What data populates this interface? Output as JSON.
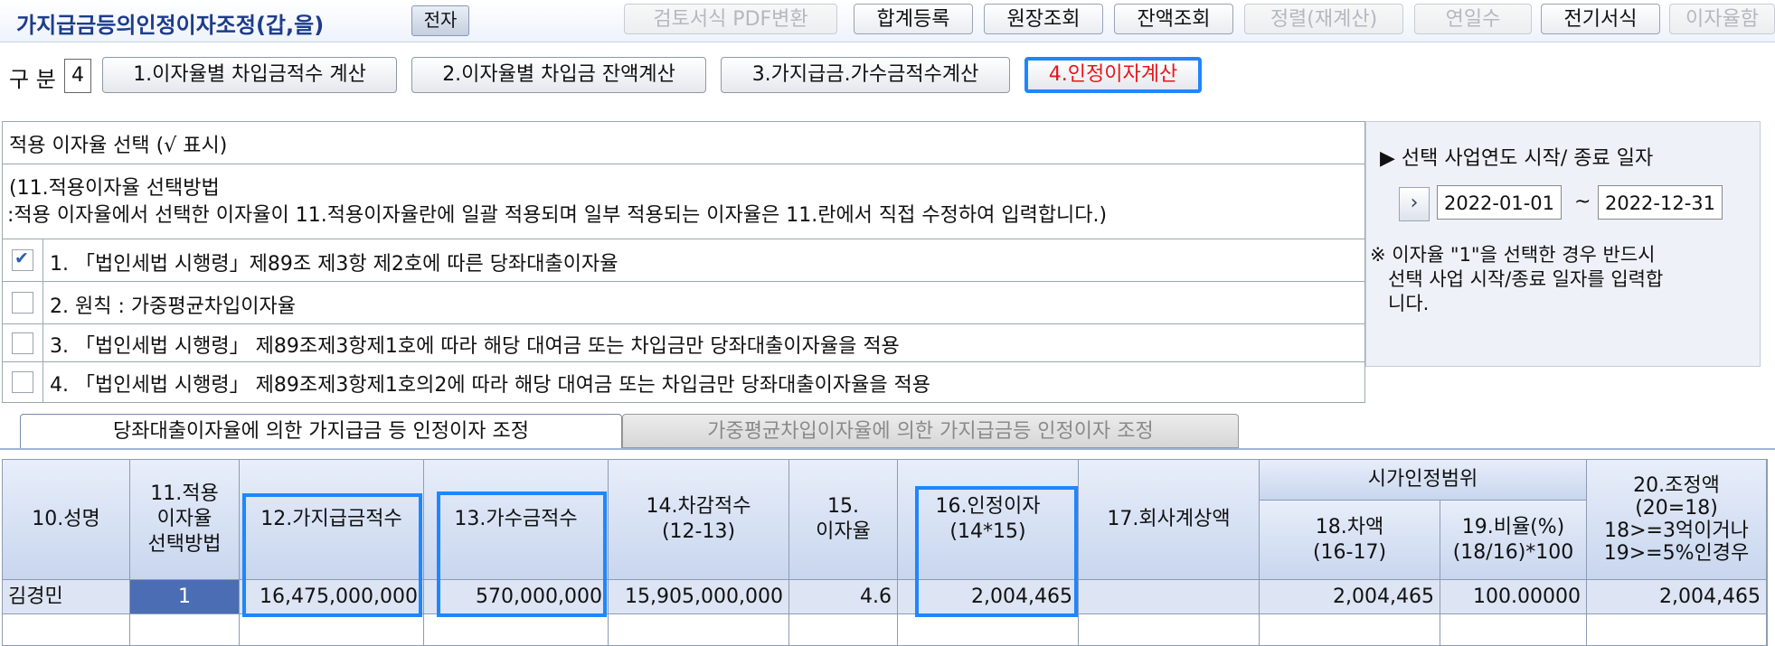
{
  "toolbar": {
    "title": "가지급금등의인정이자조정(갑,을)",
    "electronic_button": "전자",
    "buttons": [
      {
        "label": "검토서식 PDF변환",
        "enabled": false
      },
      {
        "label": "합계등록",
        "enabled": true
      },
      {
        "label": "원장조회",
        "enabled": true
      },
      {
        "label": "잔액조회",
        "enabled": true
      },
      {
        "label": "정렬(재계산)",
        "enabled": false
      },
      {
        "label": "연일수",
        "enabled": false
      },
      {
        "label": "전기서식",
        "enabled": true
      },
      {
        "label": "이자율함",
        "enabled": false
      }
    ]
  },
  "category": {
    "label": "구 분",
    "value": "4",
    "buttons": [
      "1.이자율별 차입금적수 계산",
      "2.이자율별 차입금 잔액계산",
      "3.가지급금.가수금적수계산",
      "4.인정이자계산"
    ],
    "active_index": 3
  },
  "rate_selection": {
    "header": "적용 이자율 선택 (√ 표시)",
    "method_line1": "(11.적용이자율 선택방법",
    "method_line2": " :적용 이자율에서 선택한 이자율이 11.적용이자율란에 일괄 적용되며 일부 적용되는 이자율은 11.란에서 직접 수정하여 입력합니다.)",
    "options": [
      {
        "text": "1. 「법인세법 시행령」제89조 제3항 제2호에 따른 당좌대출이자율",
        "checked": true
      },
      {
        "text": "2.  원칙 : 가중평균차입이자율",
        "checked": false
      },
      {
        "text": "3. 「법인세법 시행령」 제89조제3항제1호에 따라 해당 대여금 또는 차입금만 당좌대출이자율을 적용",
        "checked": false
      },
      {
        "text": "4. 「법인세법 시행령」 제89조제3항제1호의2에 따라 해당 대여금 또는 차입금만 당좌대출이자율을 적용",
        "checked": false
      }
    ]
  },
  "date_panel": {
    "title": "▶ 선택 사업연도 시작/ 종료 일자",
    "start_date": "2022-01-01",
    "tilde": "~",
    "end_date": "2022-12-31",
    "note_line1": "※ 이자율 \"1\"을 선택한 경우 반드시",
    "note_line2": "   선택 사업 시작/종료 일자를 입력합",
    "note_line3": "   니다."
  },
  "tabs": {
    "active": "당좌대출이자율에 의한 가지급금 등 인정이자 조정",
    "inactive": "가중평균차입이자율에 의한 가지급금등 인정이자 조정"
  },
  "grid": {
    "headers": {
      "c10": "10.성명",
      "c11": [
        "11.적용",
        "이자율",
        "선택방법"
      ],
      "c12": "12.가지급금적수",
      "c13": "13.가수금적수",
      "c14": [
        "14.차감적수",
        "(12-13)"
      ],
      "c15": [
        "15.",
        "이자율"
      ],
      "c16": [
        "16.인정이자",
        "(14*15)"
      ],
      "c17": "17.회사계상액",
      "group": "시가인정범위",
      "c18": [
        "18.차액",
        "(16-17)"
      ],
      "c19": [
        "19.비율(%)",
        "(18/16)*100"
      ],
      "c20": [
        "20.조정액",
        "(20=18)",
        "18>=3억이거나",
        "19>=5%인경우"
      ]
    },
    "row": {
      "name": "김경민",
      "method": "1",
      "provisional_payment": "16,475,000,000",
      "temporary_receipt": "570,000,000",
      "net": "15,905,000,000",
      "rate": "4.6",
      "recognized_interest": "2,004,465",
      "company_amount": "",
      "difference": "2,004,465",
      "ratio": "100.00000",
      "adjustment": "2,004,465"
    }
  }
}
